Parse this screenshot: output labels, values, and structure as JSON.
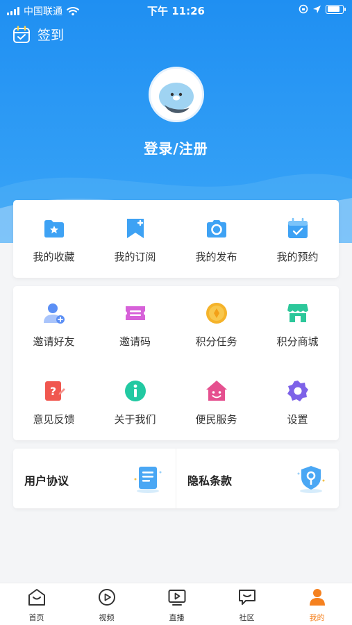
{
  "status_bar": {
    "carrier": "中国联通",
    "time": "下午 11:26",
    "battery_percent": 85
  },
  "header": {
    "sign_in_label": "签到",
    "login_label": "登录/注册"
  },
  "quick_actions": [
    {
      "label": "我的收藏",
      "icon": "folder-star-icon"
    },
    {
      "label": "我的订阅",
      "icon": "bookmark-plus-icon"
    },
    {
      "label": "我的发布",
      "icon": "camera-icon"
    },
    {
      "label": "我的预约",
      "icon": "calendar-check-icon"
    }
  ],
  "services": [
    {
      "label": "邀请好友",
      "icon": "invite-friend-icon"
    },
    {
      "label": "邀请码",
      "icon": "ticket-icon"
    },
    {
      "label": "积分任务",
      "icon": "coin-icon"
    },
    {
      "label": "积分商城",
      "icon": "store-icon"
    },
    {
      "label": "意见反馈",
      "icon": "feedback-icon"
    },
    {
      "label": "关于我们",
      "icon": "info-icon"
    },
    {
      "label": "便民服务",
      "icon": "home-smile-icon"
    },
    {
      "label": "设置",
      "icon": "settings-gear-icon"
    }
  ],
  "agreements": [
    {
      "label": "用户协议",
      "icon": "document-icon"
    },
    {
      "label": "隐私条款",
      "icon": "privacy-shield-icon"
    }
  ],
  "tabs": [
    {
      "label": "首页",
      "icon": "home-icon",
      "active": false
    },
    {
      "label": "视频",
      "icon": "video-icon",
      "active": false
    },
    {
      "label": "直播",
      "icon": "live-tv-icon",
      "active": false
    },
    {
      "label": "社区",
      "icon": "community-chat-icon",
      "active": false
    },
    {
      "label": "我的",
      "icon": "profile-icon",
      "active": true
    }
  ],
  "colors": {
    "brand_blue": "#1f8ff2",
    "active_tab": "#f5811f",
    "background": "#f4f5f7"
  }
}
